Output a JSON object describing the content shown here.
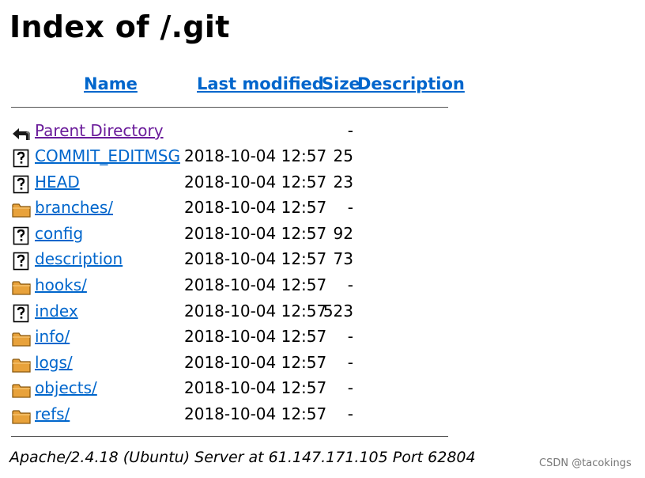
{
  "title": "Index of /.git",
  "columns": {
    "name": "Name",
    "last_modified": "Last modified",
    "size": "Size",
    "description": "Description"
  },
  "parent": {
    "name": "Parent Directory",
    "size": "-",
    "icon": "back-icon"
  },
  "entries": [
    {
      "name": "COMMIT_EDITMSG",
      "date": "2018-10-04 12:57",
      "size": "25",
      "icon": "unknown-file-icon"
    },
    {
      "name": "HEAD",
      "date": "2018-10-04 12:57",
      "size": "23",
      "icon": "unknown-file-icon"
    },
    {
      "name": "branches/",
      "date": "2018-10-04 12:57",
      "size": "-",
      "icon": "folder-icon"
    },
    {
      "name": "config",
      "date": "2018-10-04 12:57",
      "size": "92",
      "icon": "unknown-file-icon"
    },
    {
      "name": "description",
      "date": "2018-10-04 12:57",
      "size": "73",
      "icon": "unknown-file-icon"
    },
    {
      "name": "hooks/",
      "date": "2018-10-04 12:57",
      "size": "-",
      "icon": "folder-icon"
    },
    {
      "name": "index",
      "date": "2018-10-04 12:57",
      "size": "523",
      "icon": "unknown-file-icon"
    },
    {
      "name": "info/",
      "date": "2018-10-04 12:57",
      "size": "-",
      "icon": "folder-icon"
    },
    {
      "name": "logs/",
      "date": "2018-10-04 12:57",
      "size": "-",
      "icon": "folder-icon"
    },
    {
      "name": "objects/",
      "date": "2018-10-04 12:57",
      "size": "-",
      "icon": "folder-icon"
    },
    {
      "name": "refs/",
      "date": "2018-10-04 12:57",
      "size": "-",
      "icon": "folder-icon"
    }
  ],
  "footer": "Apache/2.4.18 (Ubuntu) Server at 61.147.171.105 Port 62804",
  "watermark": "CSDN @tacokings",
  "colors": {
    "link": "#0066cc",
    "visited_link": "#6a1b9a",
    "folder": "#e8a23b"
  }
}
